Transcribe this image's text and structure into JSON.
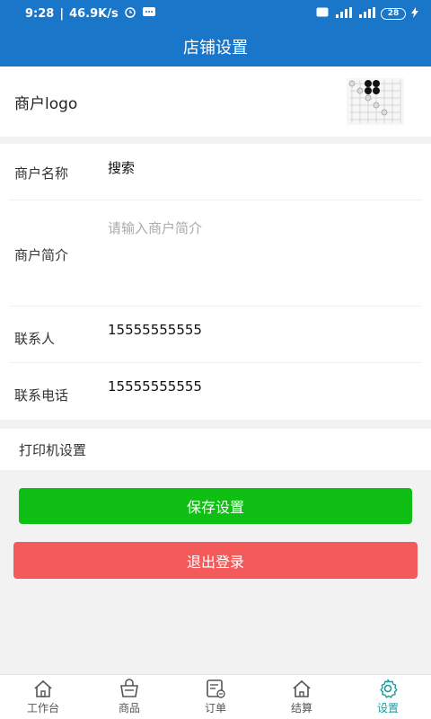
{
  "status_bar": {
    "time": "9:28",
    "speed": "46.9K/s",
    "battery": "28"
  },
  "header": {
    "title": "店铺设置"
  },
  "logo_row": {
    "label": "商户logo"
  },
  "form": {
    "name_label": "商户名称",
    "name_value": "搜索",
    "intro_label": "商户简介",
    "intro_placeholder": "请输入商户简介",
    "contact_label": "联系人",
    "contact_value": "15555555555",
    "phone_label": "联系电话",
    "phone_value": "15555555555"
  },
  "printer": {
    "label": "打印机设置"
  },
  "buttons": {
    "save": "保存设置",
    "logout": "退出登录"
  },
  "tabs": [
    {
      "label": "工作台",
      "icon": "home-icon"
    },
    {
      "label": "商品",
      "icon": "basket-icon"
    },
    {
      "label": "订单",
      "icon": "order-icon"
    },
    {
      "label": "结算",
      "icon": "house-icon"
    },
    {
      "label": "设置",
      "icon": "gear-icon"
    }
  ],
  "colors": {
    "primary": "#1976c8",
    "save": "#0fbf14",
    "logout": "#f55a5a",
    "tab_active": "#1a9b9b"
  }
}
